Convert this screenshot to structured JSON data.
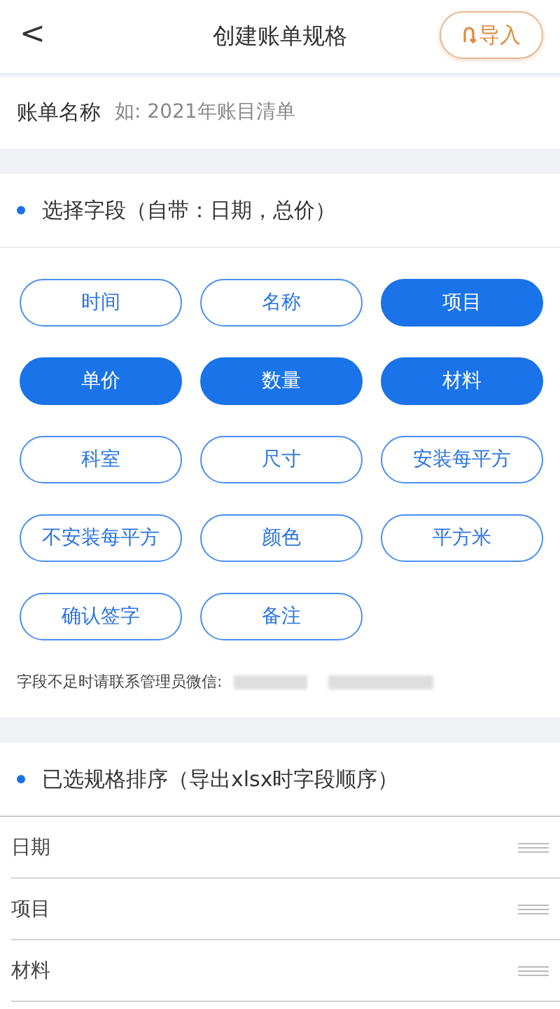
{
  "header": {
    "back_icon": "<",
    "title": "创建账单规格",
    "import_button": "导入"
  },
  "name_field": {
    "label": "账单名称",
    "placeholder": "如: 2021年账目清单"
  },
  "field_section": {
    "title": "选择字段（自带：日期，总价）",
    "fields": [
      {
        "label": "时间",
        "selected": false
      },
      {
        "label": "名称",
        "selected": false
      },
      {
        "label": "项目",
        "selected": true
      },
      {
        "label": "单价",
        "selected": true
      },
      {
        "label": "数量",
        "selected": true
      },
      {
        "label": "材料",
        "selected": true
      },
      {
        "label": "科室",
        "selected": false
      },
      {
        "label": "尺寸",
        "selected": false
      },
      {
        "label": "安装每平方",
        "selected": false
      },
      {
        "label": "不安装每平方",
        "selected": false
      },
      {
        "label": "颜色",
        "selected": false
      },
      {
        "label": "平方米",
        "selected": false
      },
      {
        "label": "确认签字",
        "selected": false
      },
      {
        "label": "备注",
        "selected": false
      }
    ],
    "hint": "字段不足时请联系管理员微信:"
  },
  "order_section": {
    "title": "已选规格排序（导出xlsx时字段顺序）",
    "rows": [
      {
        "label": "日期"
      },
      {
        "label": "项目"
      },
      {
        "label": "材料"
      }
    ]
  }
}
